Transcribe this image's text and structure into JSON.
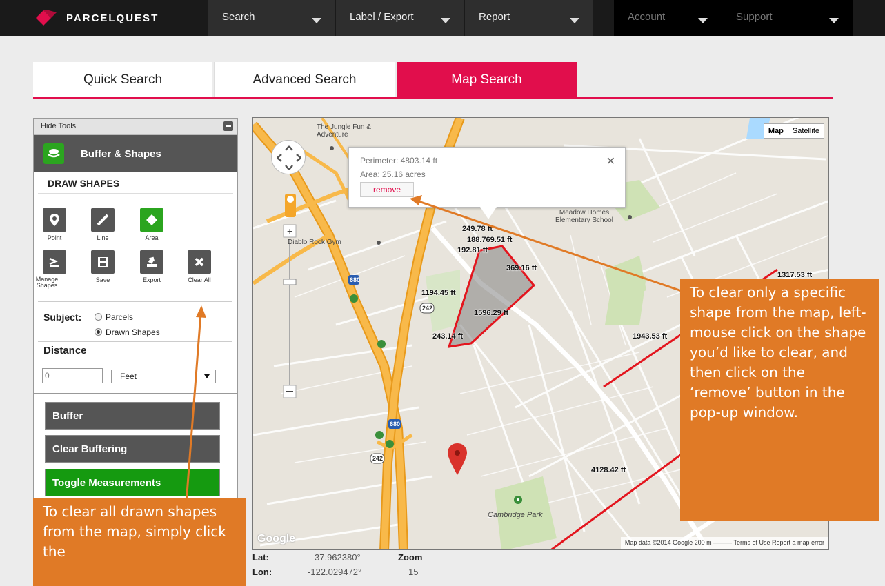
{
  "brand": {
    "name": "PARCELQUEST",
    "accent": "#e10e4c"
  },
  "nav": [
    {
      "label": "Search"
    },
    {
      "label": "Label / Export"
    },
    {
      "label": "Report"
    },
    {
      "label": "Account"
    },
    {
      "label": "Support"
    }
  ],
  "tabs": [
    {
      "label": "Quick Search",
      "active": false
    },
    {
      "label": "Advanced Search",
      "active": false
    },
    {
      "label": "Map Search",
      "active": true
    }
  ],
  "panel": {
    "hide_tools": "Hide Tools",
    "section_title": "Buffer & Shapes",
    "draw_shapes": "DRAW SHAPES",
    "tools": [
      {
        "label": "Point",
        "icon": "map-pin-icon"
      },
      {
        "label": "Line",
        "icon": "line-icon"
      },
      {
        "label": "Area",
        "icon": "polygon-icon",
        "active": true
      },
      {
        "label": "Manage Shapes",
        "icon": "manage-shapes-icon"
      },
      {
        "label": "Save",
        "icon": "save-icon"
      },
      {
        "label": "Export",
        "icon": "export-icon"
      },
      {
        "label": "Clear All",
        "icon": "close-icon"
      }
    ],
    "subject_label": "Subject:",
    "subject_options": [
      "Parcels",
      "Drawn Shapes"
    ],
    "subject_selected": "Drawn Shapes",
    "distance_label": "Distance",
    "distance_value": "0",
    "unit_value": "Feet",
    "buttons": {
      "buffer": "Buffer",
      "clear_buffering": "Clear Buffering",
      "toggle_measurements": "Toggle Measurements"
    }
  },
  "map": {
    "type_options": [
      "Map",
      "Satellite"
    ],
    "popup": {
      "perimeter": "Perimeter: 4803.14 ft",
      "area": "Area: 25.16 acres",
      "remove": "remove"
    },
    "measurements": [
      "249.78 ft",
      "188.769.51 ft",
      "192.81 ft",
      "369.16 ft",
      "1194.45 ft",
      "1596.29 ft",
      "243.14 ft",
      "1943.53 ft",
      "4128.42 ft",
      "1317.53 ft"
    ],
    "places": [
      "The Jungle Fun & Adventure",
      "Diablo Rock Gym",
      "Meadow Homes Elementary School",
      "Cambridge Park"
    ],
    "shields": [
      "680",
      "242",
      "680",
      "242"
    ],
    "attribution": "Map data ©2014 Google   200 m ———   Terms of Use   Report a map error",
    "google": "Google"
  },
  "coords": {
    "lat_label": "Lat:",
    "lat_value": "37.962380°",
    "lon_label": "Lon:",
    "lon_value": "-122.029472°",
    "zoom_label": "Zoom",
    "zoom_value": "15"
  },
  "callouts": {
    "right": "To clear only a specific shape from the map, left-mouse click on the shape you’d like to clear, and then click on the ‘remove’ button in the pop-up window.",
    "left": "To clear all drawn shapes from the map, simply click the"
  },
  "colors": {
    "callout": "#e07a26",
    "green": "#2ba51f",
    "highway": "#f4a62a",
    "shape": "#e3151e"
  }
}
